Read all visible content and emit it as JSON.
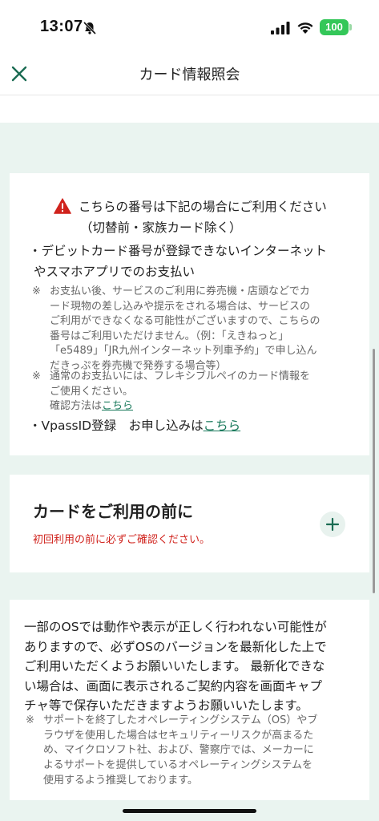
{
  "status": {
    "time": "13:07",
    "battery": "100"
  },
  "nav": {
    "title": "カード情報照会"
  },
  "warning": {
    "line1": "こちらの番号は下記の場合にご利用ください",
    "line2": "（切替前・家族カード除く）"
  },
  "bullet1": {
    "line1": "・デビットカード番号が登録できないインターネット",
    "line2": "やスマホアプリでのお支払い"
  },
  "note1": {
    "mark": "※",
    "lines": [
      "お支払い後、サービスのご利用に券売機・店頭などでカ",
      "ード現物の差し込みや提示をされる場合は、サービスの",
      "ご利用ができなくなる可能性がございますので、こちらの",
      "番号はご利用いただけません。（例：「えきねっと」",
      "「e5489」「JR九州インターネット列車予約」で申し込ん",
      "だきっぷを券売機で発券する場合等）"
    ]
  },
  "note2": {
    "mark": "※",
    "line1": "通常のお支払いには、フレキシブルペイのカード情報を",
    "line2": "ご使用ください。",
    "line3_prefix": "確認方法は",
    "link": "こちら"
  },
  "bullet2": {
    "prefix": "・VpassID登録　お申し込みは",
    "link": "こちら"
  },
  "before_use": {
    "title": "カードをご利用の前に",
    "subtitle": "初回利用の前に必ずご確認ください。"
  },
  "os_notice": {
    "lines": [
      "一部のOSでは動作や表示が正しく行われない可能性が",
      "ありますので、必ずOSのバージョンを最新化した上で",
      "ご利用いただくようお願いいたします。 最新化できな",
      "い場合は、画面に表示されるご契約内容を画面キャプ",
      "チャ等で保存いただきますようお願いいたします。"
    ]
  },
  "os_note": {
    "mark": "※",
    "lines": [
      "サポートを終了したオペレーティングシステム（OS）やブ",
      "ラウザを使用した場合はセキュリティーリスクが高まるた",
      "め、マイクロソフト社、および、警察庁では、メーカーに",
      "よるサポートを提供しているオペレーティングシステムを",
      "使用するよう推奨しております。"
    ]
  },
  "colors": {
    "accent": "#1a7a5c",
    "warning_red": "#d0231d",
    "content_bg": "#eaf4f0"
  },
  "icons": {
    "close": "close-icon",
    "warning": "warning-icon",
    "expand": "plus-icon"
  }
}
